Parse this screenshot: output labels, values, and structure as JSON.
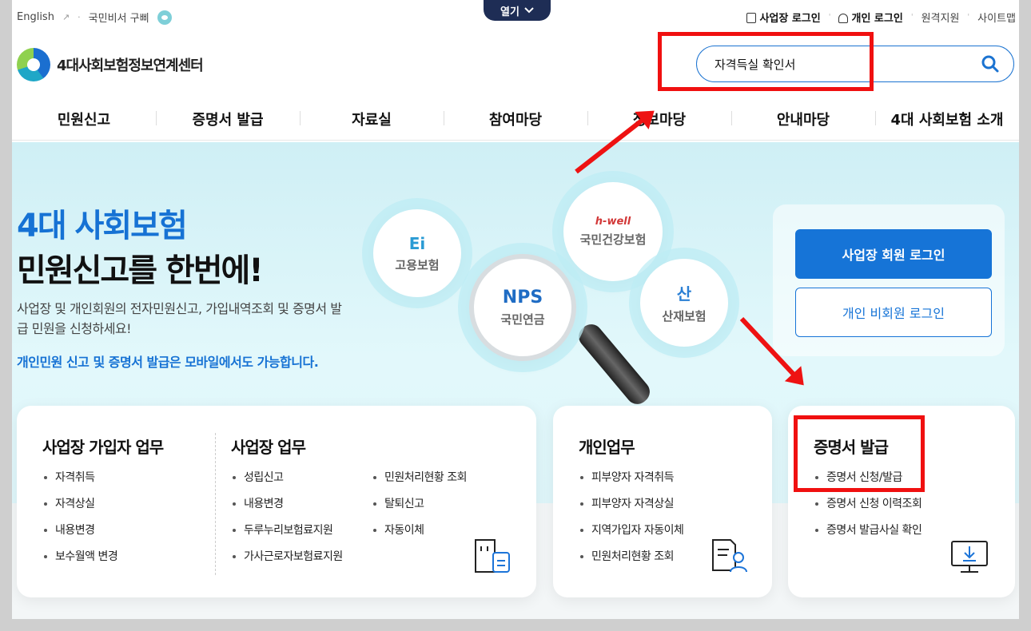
{
  "util": {
    "english": "English",
    "secretary": "국민비서 구삐",
    "open_tab": "열기",
    "biz_login": "사업장 로그인",
    "personal_login": "개인 로그인",
    "remote_support": "원격지원",
    "sitemap": "사이트맵"
  },
  "logo": {
    "text": "4대사회보험정보연계센터"
  },
  "search": {
    "value": "자격득실 확인서"
  },
  "nav": [
    "민원신고",
    "증명서 발급",
    "자료실",
    "참여마당",
    "정보마당",
    "안내마당",
    "4대 사회보험 소개"
  ],
  "hero": {
    "title1": "4대 사회보험",
    "title2": "민원신고를 한번에!",
    "desc": "사업장 및 개인회원의 전자민원신고, 가입내역조회 및 증명서 발급 민원을 신청하세요!",
    "note": "개인민원 신고 및 증명서 발급은 모바일에서도 가능합니다."
  },
  "bubbles": {
    "employment": {
      "mark": "Ei",
      "label": "고용보험"
    },
    "health": {
      "mark": "h-well",
      "label": "국민건강보험"
    },
    "pension": {
      "mark": "NPS",
      "label": "국민연금"
    },
    "industrial": {
      "mark": "산",
      "label": "산재보험"
    }
  },
  "login": {
    "biz_member": "사업장 회원 로그인",
    "personal_nonmember": "개인 비회원 로그인"
  },
  "cards": {
    "biz_subscriber": {
      "title": "사업장 가입자 업무",
      "items": [
        "자격취득",
        "자격상실",
        "내용변경",
        "보수월액 변경"
      ]
    },
    "biz": {
      "title": "사업장 업무",
      "col1": [
        "성립신고",
        "내용변경",
        "두루누리보험료지원",
        "가사근로자보험료지원"
      ],
      "col2": [
        "민원처리현황 조회",
        "탈퇴신고",
        "자동이체"
      ]
    },
    "personal": {
      "title": "개인업무",
      "items": [
        "피부양자 자격취득",
        "피부양자 자격상실",
        "지역가입자 자동이체",
        "민원처리현황 조회"
      ]
    },
    "certificate": {
      "title": "증명서 발급",
      "items": [
        "증명서 신청/발급",
        "증명서 신청 이력조회",
        "증명서 발급사실 확인"
      ]
    }
  },
  "colors": {
    "primary": "#1674d7",
    "annotation": "#f01010",
    "open_tab": "#1e2d55"
  }
}
